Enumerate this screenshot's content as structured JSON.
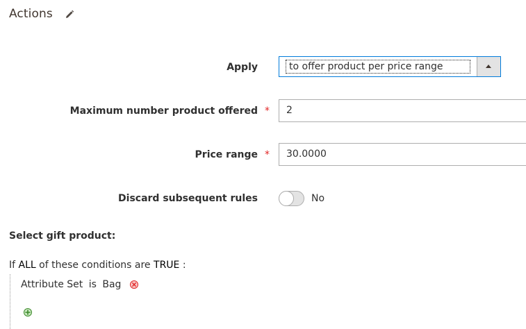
{
  "section": {
    "title": "Actions"
  },
  "fields": {
    "apply": {
      "label": "Apply",
      "value": "to offer product per price range"
    },
    "max_products": {
      "label": "Maximum number product offered",
      "required_mark": "*",
      "value": "2"
    },
    "price_range": {
      "label": "Price range",
      "required_mark": "*",
      "value": "30.0000"
    },
    "discard_rules": {
      "label": "Discard subsequent rules",
      "state_text": "No",
      "enabled": false
    }
  },
  "gift": {
    "heading": "Select gift product:",
    "conditions": {
      "prefix": "If",
      "aggregator": "ALL",
      "middle": "of these conditions are",
      "value": "TRUE",
      "suffix": ":"
    },
    "rules": [
      {
        "attribute": "Attribute Set",
        "operator": "is",
        "value": "Bag"
      }
    ]
  },
  "icons": {
    "edit": "pencil-icon",
    "remove": "remove-circle-icon",
    "add": "add-circle-icon"
  },
  "colors": {
    "focus_border": "#007bdb",
    "required": "#e22626",
    "remove_icon": "#e22626",
    "add_icon": "#3d8a2c"
  }
}
